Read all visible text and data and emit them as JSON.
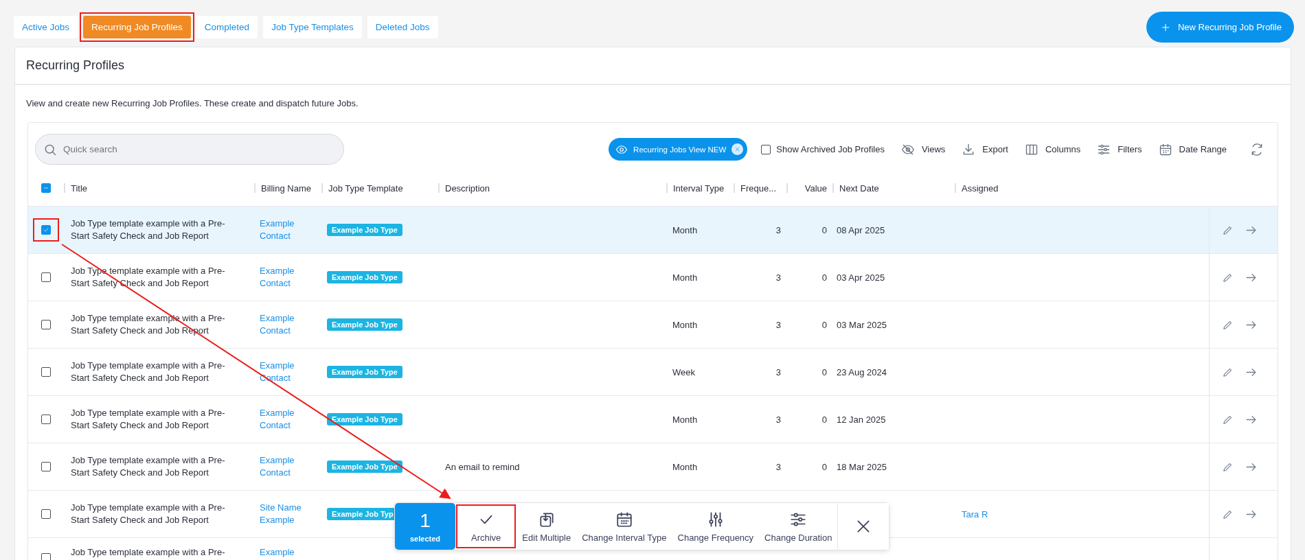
{
  "tabs": [
    {
      "label": "Active Jobs",
      "selected": false,
      "highlighted": false
    },
    {
      "label": "Recurring Job Profiles",
      "selected": true,
      "highlighted": true
    },
    {
      "label": "Completed",
      "selected": false,
      "highlighted": false
    },
    {
      "label": "Job Type Templates",
      "selected": false,
      "highlighted": false
    },
    {
      "label": "Deleted Jobs",
      "selected": false,
      "highlighted": false
    }
  ],
  "new_button": {
    "label": "New Recurring Job Profile"
  },
  "card": {
    "title": "Recurring Profiles",
    "description": "View and create new Recurring Job Profiles. These create and dispatch future Jobs."
  },
  "search": {
    "placeholder": "Quick search"
  },
  "view_chip": {
    "label": "Recurring Jobs View NEW"
  },
  "show_archived": {
    "label": "Show Archived Job Profiles",
    "checked": false
  },
  "toolbar": [
    {
      "kind": "views",
      "label": "Views"
    },
    {
      "kind": "export",
      "label": "Export"
    },
    {
      "kind": "columns",
      "label": "Columns"
    },
    {
      "kind": "filters",
      "label": "Filters"
    },
    {
      "kind": "date",
      "label": "Date Range"
    },
    {
      "kind": "refresh"
    }
  ],
  "table": {
    "select_all": {
      "indeterminate": true
    },
    "columns": [
      "Title",
      "Billing Name",
      "Job Type Template",
      "Description",
      "Interval Type",
      "Freque...",
      "Value",
      "Next Date",
      "Assigned"
    ],
    "rows": [
      {
        "selected": true,
        "highlighted": true,
        "title": "Job Type template example with a Pre-Start Safety Check and Job Report",
        "billing_name": "Example Contact",
        "template": "Example Job Type",
        "interval": "Month",
        "frequency": "3",
        "value": "0",
        "next_date": "08 Apr 2025"
      },
      {
        "selected": false,
        "highlighted": false,
        "title": "Job Type template example with a Pre-Start Safety Check and Job Report",
        "billing_name": "Example Contact",
        "template": "Example Job Type",
        "interval": "Month",
        "frequency": "3",
        "value": "0",
        "next_date": "03 Apr 2025"
      },
      {
        "selected": false,
        "highlighted": false,
        "title": "Job Type template example with a Pre-Start Safety Check and Job Report",
        "billing_name": "Example Contact",
        "template": "Example Job Type",
        "interval": "Month",
        "frequency": "3",
        "value": "0",
        "next_date": "03 Mar 2025"
      },
      {
        "selected": false,
        "highlighted": false,
        "title": "Job Type template example with a Pre-Start Safety Check and Job Report",
        "billing_name": "Example Contact",
        "template": "Example Job Type",
        "interval": "Week",
        "frequency": "3",
        "value": "0",
        "next_date": "23 Aug 2024"
      },
      {
        "selected": false,
        "highlighted": false,
        "title": "Job Type template example with a Pre-Start Safety Check and Job Report",
        "billing_name": "Example Contact",
        "template": "Example Job Type",
        "interval": "Month",
        "frequency": "3",
        "value": "0",
        "next_date": "12 Jan 2025"
      },
      {
        "selected": false,
        "highlighted": false,
        "title": "Job Type template example with a Pre-Start Safety Check and Job Report",
        "billing_name": "Example Contact",
        "template": "Example Job Type",
        "description": "An email to remind",
        "interval": "Month",
        "frequency": "3",
        "value": "0",
        "next_date": "18 Mar 2025"
      },
      {
        "selected": false,
        "highlighted": false,
        "title": "Job Type template example with a Pre-Start Safety Check and Job Report",
        "billing_name": "Site Name Example",
        "template": "Example Job Typ",
        "assigned": "Tara R"
      },
      {
        "selected": false,
        "highlighted": false,
        "title": "Job Type template example with a Pre-",
        "billing_name": "Example"
      }
    ]
  },
  "action_bar": {
    "count": "1",
    "count_label": "selected",
    "actions": [
      {
        "kind": "archive",
        "label": "Archive",
        "highlighted": true
      },
      {
        "kind": "edit",
        "label": "Edit Multiple",
        "highlighted": false
      },
      {
        "kind": "interval",
        "label": "Change Interval Type",
        "highlighted": false
      },
      {
        "kind": "frequency",
        "label": "Change Frequency",
        "highlighted": false
      },
      {
        "kind": "duration",
        "label": "Change Duration",
        "highlighted": false
      }
    ]
  }
}
